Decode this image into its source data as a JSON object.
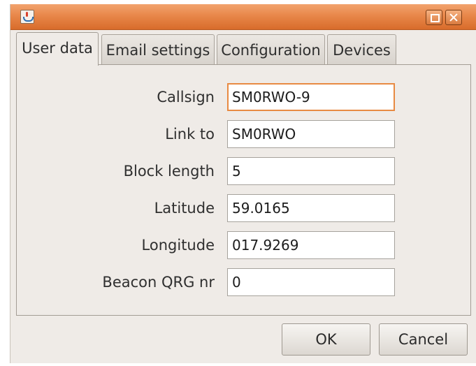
{
  "window": {
    "title": ""
  },
  "tabs": [
    {
      "label": "User data"
    },
    {
      "label": "Email settings"
    },
    {
      "label": "Configuration"
    },
    {
      "label": "Devices"
    }
  ],
  "active_tab": "User data",
  "form": {
    "fields": [
      {
        "label": "Callsign",
        "value": "SM0RWO-9"
      },
      {
        "label": "Link to",
        "value": "SM0RWO"
      },
      {
        "label": "Block length",
        "value": "5"
      },
      {
        "label": "Latitude",
        "value": "59.0165"
      },
      {
        "label": "Longitude",
        "value": "017.9269"
      },
      {
        "label": "Beacon QRG nr",
        "value": "0"
      }
    ]
  },
  "buttons": {
    "ok": "OK",
    "cancel": "Cancel"
  },
  "colors": {
    "titlebar": "#e8874a",
    "focus": "#e88a42",
    "window_bg": "#efebe7"
  }
}
